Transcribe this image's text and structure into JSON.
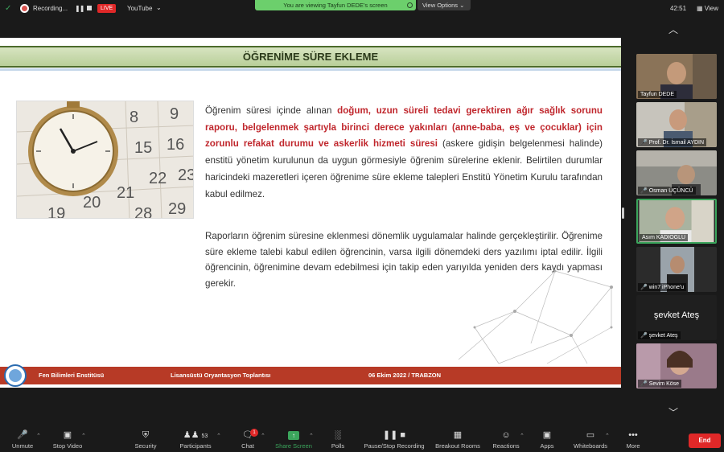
{
  "topbar": {
    "recording_label": "Recording...",
    "live_label": "LIVE",
    "youtube_label": "YouTube",
    "viewing_banner": "You are viewing Tayfun DEDE's screen",
    "view_options": "View Options",
    "time": "42:51",
    "view_label": "View"
  },
  "slide": {
    "title": "ÖĞRENİME SÜRE EKLEME",
    "p1_a": "Öğrenim süresi içinde alınan ",
    "p1_highlight": "doğum, uzun süreli tedavi gerektiren ağır sağlık sorunu raporu, belgelenmek şartıyla birinci derece yakınları (anne-baba, eş ve çocuklar) için zorunlu refakat durumu ve askerlik hizmeti süresi",
    "p1_b": " (askere gidişin belgelenmesi halinde) enstitü yönetim kurulunun da uygun görmesiyle öğrenim sürelerine eklenir. Belirtilen durumlar haricindeki mazeretleri içeren öğrenime süre ekleme talepleri Enstitü Yönetim Kurulu tarafından kabul edilmez.",
    "p2": "Raporların öğrenim süresine eklenmesi dönemlik uygulamalar halinde gerçekleştirilir. Öğrenime süre ekleme talebi kabul edilen öğrencinin, varsa ilgili dönemdeki ders yazılımı iptal edilir. İlgili öğrencinin, öğrenimine devam edebilmesi için takip eden yarıyılda yeniden ders kaydı yapması gerekir.",
    "calendar_numbers": [
      "8",
      "9",
      "15",
      "16",
      "22",
      "23",
      "20",
      "21",
      "19",
      "28",
      "29"
    ],
    "footer": {
      "institute": "Fen Bilimleri Enstitüsü",
      "meeting": "Lisansüstü Oryantasyon Toplantısı",
      "date_place": "06 Ekim 2022 / TRABZON"
    }
  },
  "participants": [
    {
      "name": "Tayfun DEDE",
      "muted": false
    },
    {
      "name": "Prof. Dr. İsmail AYDIN",
      "muted": true
    },
    {
      "name": "Osman ÜÇÜNCÜ",
      "muted": true
    },
    {
      "name": "Asım KADIOGLU",
      "muted": false
    },
    {
      "name": "win7 iPhone'u",
      "muted": true
    },
    {
      "name": "şevket Ateş",
      "muted": true,
      "big_label": "şevket Ateş"
    },
    {
      "name": "Sevim Köse",
      "muted": true
    }
  ],
  "toolbar": {
    "unmute": "Unmute",
    "stop_video": "Stop Video",
    "security": "Security",
    "participants": "Participants",
    "participants_count": "53",
    "chat": "Chat",
    "chat_badge": "1",
    "share_screen": "Share Screen",
    "polls": "Polls",
    "pause_recording": "Pause/Stop Recording",
    "breakout": "Breakout Rooms",
    "reactions": "Reactions",
    "apps": "Apps",
    "whiteboards": "Whiteboards",
    "more": "More",
    "end": "End"
  },
  "colors": {
    "slide_title_bar": "#4c6b2c",
    "highlight_text": "#c0272d",
    "footer": "#b73a26",
    "accent_green": "#3ba55c",
    "end_red": "#e02828"
  }
}
